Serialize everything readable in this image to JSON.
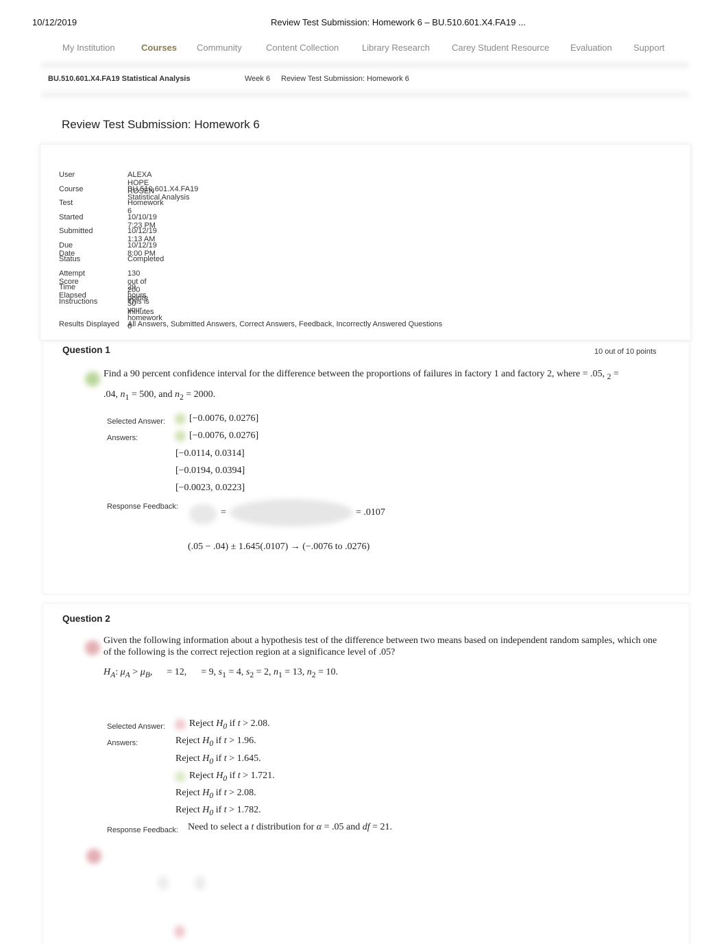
{
  "print_header": {
    "date": "10/12/2019",
    "title": "Review Test Submission: Homework 6 – BU.510.601.X4.FA19 ..."
  },
  "nav": [
    "My Institution",
    "Courses",
    "Community",
    "Content Collection",
    "Library Research",
    "Carey Student Resource",
    "Evaluation",
    "Support"
  ],
  "nav_active": "Courses",
  "breadcrumb": [
    "BU.510.601.X4.FA19 Statistical Analysis",
    "Week 6",
    "Review Test Submission: Homework 6"
  ],
  "page_title": "Review Test Submission: Homework 6",
  "info": [
    {
      "label": "User",
      "value": "ALEXA HOPE ROSEN"
    },
    {
      "label": "Course",
      "value": "BU.510.601.X4.FA19 Statistical Analysis"
    },
    {
      "label": "Test",
      "value": "Homework 6"
    },
    {
      "label": "Started",
      "value": "10/10/19 7:23 PM"
    },
    {
      "label": "Submitted",
      "value": "10/12/19 1:13 AM"
    },
    {
      "label": "Due Date",
      "value": "10/12/19 8:00 PM"
    },
    {
      "label": "Status",
      "value": "Completed"
    },
    {
      "label": "Attempt Score",
      "value": "130 out of 200 points"
    },
    {
      "label": "Time Elapsed",
      "value": "29 hours, 50 minutes"
    },
    {
      "label": "Instructions",
      "value": "This is your homework 6"
    }
  ],
  "results_displayed": {
    "label": "Results Displayed",
    "value": "All Answers, Submitted Answers, Correct Answers, Feedback, Incorrectly Answered Questions"
  },
  "labels": {
    "selected": "Selected Answer:",
    "answers": "Answers:",
    "feedback": "Response Feedback:"
  },
  "colors": {
    "correct": "#8dbb5a",
    "incorrect": "#c9606a",
    "nav_active": "#8a7a50"
  },
  "q1": {
    "title": "Question 1",
    "points": "10 out of 10 points",
    "status_icon": "correct-check-icon",
    "text1": [
      [
        "Find a 90 percent confidence interval for the difference between the proportions of failures in factory 1 and factory 2, where ",
        ""
      ],
      [
        "= .05, ",
        ""
      ],
      [
        "2",
        "sub"
      ],
      [
        " =",
        ""
      ]
    ],
    "text2": [
      [
        ".04, ",
        ""
      ],
      [
        "n",
        "i"
      ],
      [
        "1",
        "sub"
      ],
      [
        " = 500, and ",
        ""
      ],
      [
        "n",
        "i"
      ],
      [
        "2",
        "sub"
      ],
      [
        " = 2000.",
        ""
      ]
    ],
    "selected": "[−0.0076, 0.0276]",
    "answers": [
      "[−0.0076, 0.0276]",
      "[−0.0114, 0.0314]",
      "[−0.0194, 0.0394]",
      "[−0.0023, 0.0223]"
    ],
    "feedback_eq": "=",
    "feedback_result": "= .0107",
    "feedback_line2": "(.05 − .04) ± 1.645(.0107) → (−.0076 to .0276)"
  },
  "q2": {
    "title": "Question 2",
    "status_icon": "incorrect-x-icon",
    "text": "Given the following information about a hypothesis test of the difference between two means based on independent random samples, which one of the following is the correct rejection region at a significance level of .05?",
    "given": [
      [
        "H",
        "i"
      ],
      [
        "A",
        "subi"
      ],
      [
        ": ",
        ""
      ],
      [
        "μ",
        "i"
      ],
      [
        "A",
        "subi"
      ],
      [
        " > ",
        ""
      ],
      [
        "μ",
        "i"
      ],
      [
        "B",
        "subi"
      ],
      [
        ",",
        ""
      ],
      [
        "      = 12,      ",
        ""
      ],
      [
        "= 9, ",
        ""
      ],
      [
        "s",
        "i"
      ],
      [
        "1",
        "sub"
      ],
      [
        " = 4, ",
        ""
      ],
      [
        "s",
        "i"
      ],
      [
        "2",
        "sub"
      ],
      [
        " = 2, ",
        ""
      ],
      [
        "n",
        "i"
      ],
      [
        "1",
        "sub"
      ],
      [
        " = 13, ",
        ""
      ],
      [
        "n",
        "i"
      ],
      [
        "2",
        "sub"
      ],
      [
        " = 10.",
        ""
      ]
    ],
    "selected": "2.08",
    "answers": [
      "1.96",
      "1.645",
      "1.721",
      "2.08",
      "1.782"
    ],
    "reject_prefix": "Reject ",
    "h0": "H",
    "h0_sub": "0",
    "if_t": " if ",
    "t": "t",
    "feedback": [
      [
        "Need to select a ",
        ""
      ],
      [
        "t",
        "i"
      ],
      [
        " distribution for ",
        ""
      ],
      [
        "α",
        "i"
      ],
      [
        " = .05 and ",
        ""
      ],
      [
        "df",
        "i"
      ],
      [
        " = 21.",
        ""
      ]
    ]
  }
}
